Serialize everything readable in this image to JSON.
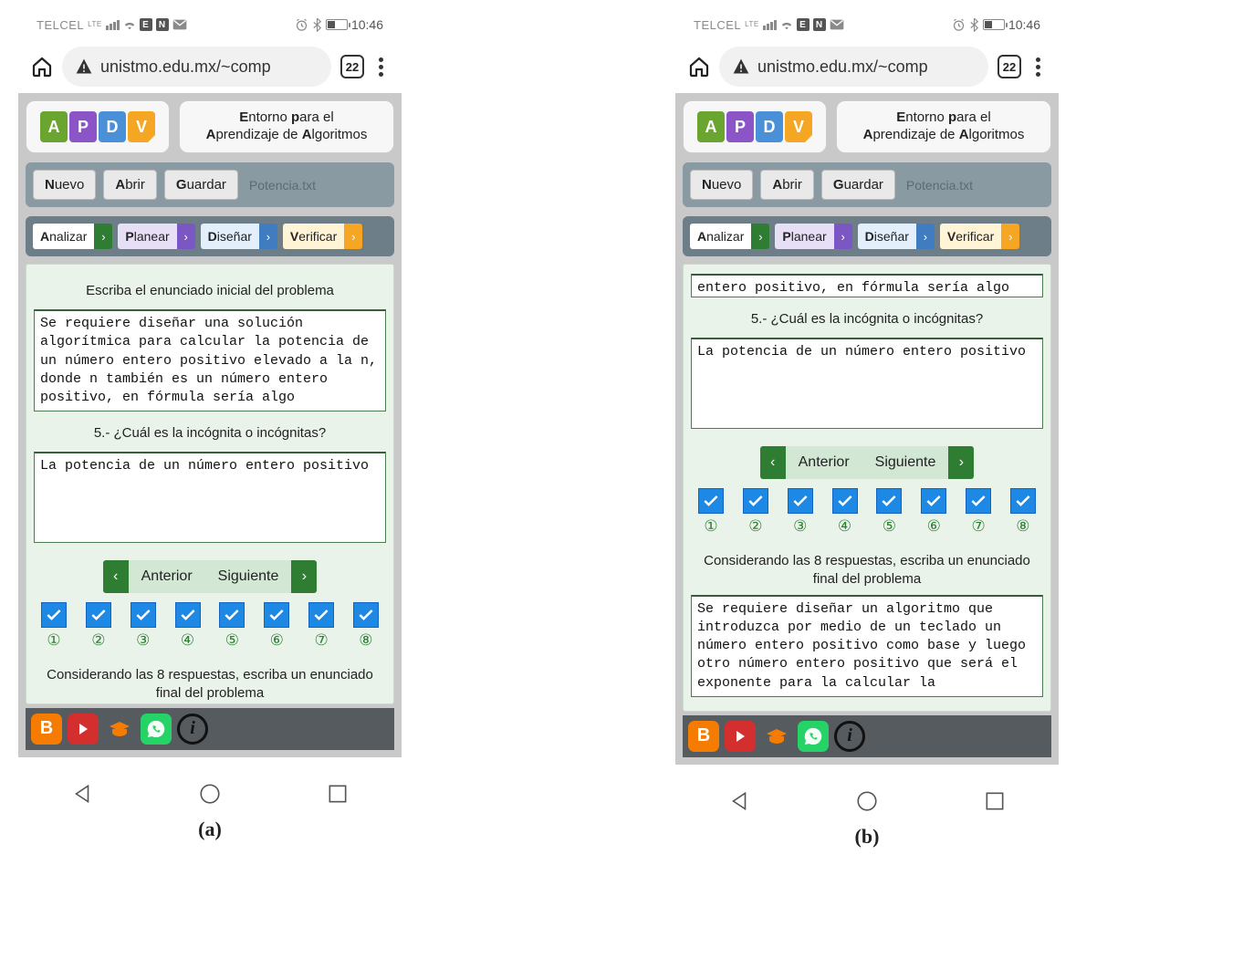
{
  "status": {
    "carrier": "TELCEL",
    "lte": "LTE",
    "time": "10:46"
  },
  "browser": {
    "url": "unistmo.edu.mx/~comp",
    "tab_count": "22"
  },
  "logo": {
    "a": "A",
    "p": "P",
    "d": "D",
    "v": "V"
  },
  "app_title_line1_pre": "E",
  "app_title_line1_mid": "ntorno ",
  "app_title_line1_b2": "p",
  "app_title_line1_post": "ara el",
  "app_title_line2_b1": "A",
  "app_title_line2_mid": "prendizaje de ",
  "app_title_line2_b2": "A",
  "app_title_line2_post": "lgoritmos",
  "file": {
    "nuevo_b": "N",
    "nuevo": "uevo",
    "abrir_b": "A",
    "abrir": "brir",
    "guardar_b": "G",
    "guardar": "uardar",
    "name": "Potencia.txt"
  },
  "tabs": {
    "t1_b": "A",
    "t1": "nalizar",
    "t2_b": "P",
    "t2": "lanear",
    "t3_b": "D",
    "t3": "iseñar",
    "t4_b": "V",
    "t4": "erificar"
  },
  "panelA": {
    "prompt1": "Escriba el enunciado inicial del problema",
    "ta1": "Se requiere diseñar una solución algorítmica para calcular la potencia de un número entero positivo elevado a la n, donde n también es un número entero positivo, en fórmula sería algo",
    "q5": "5.- ¿Cuál es la incógnita o incógnitas?",
    "ta2": "La potencia de un número entero positivo",
    "prev": "Anterior",
    "next": "Siguiente",
    "finalp": "Considerando las 8 respuestas, escriba un enunciado final del problema"
  },
  "panelB": {
    "ta_top": "entero positivo, en fórmula sería algo",
    "q5": "5.- ¿Cuál es la incógnita o incógnitas?",
    "ta2": "La potencia de un número entero positivo",
    "prev": "Anterior",
    "next": "Siguiente",
    "finalp": "Considerando las 8 respuestas, escriba un enunciado final del problema",
    "ta3": "Se requiere diseñar un algoritmo que introduzca por medio de un teclado un número entero positivo como base y luego otro número entero positivo que será el exponente para la calcular la"
  },
  "checks": [
    "①",
    "②",
    "③",
    "④",
    "⑤",
    "⑥",
    "⑦",
    "⑧"
  ],
  "captions": {
    "a": "(a)",
    "b": "(b)"
  }
}
